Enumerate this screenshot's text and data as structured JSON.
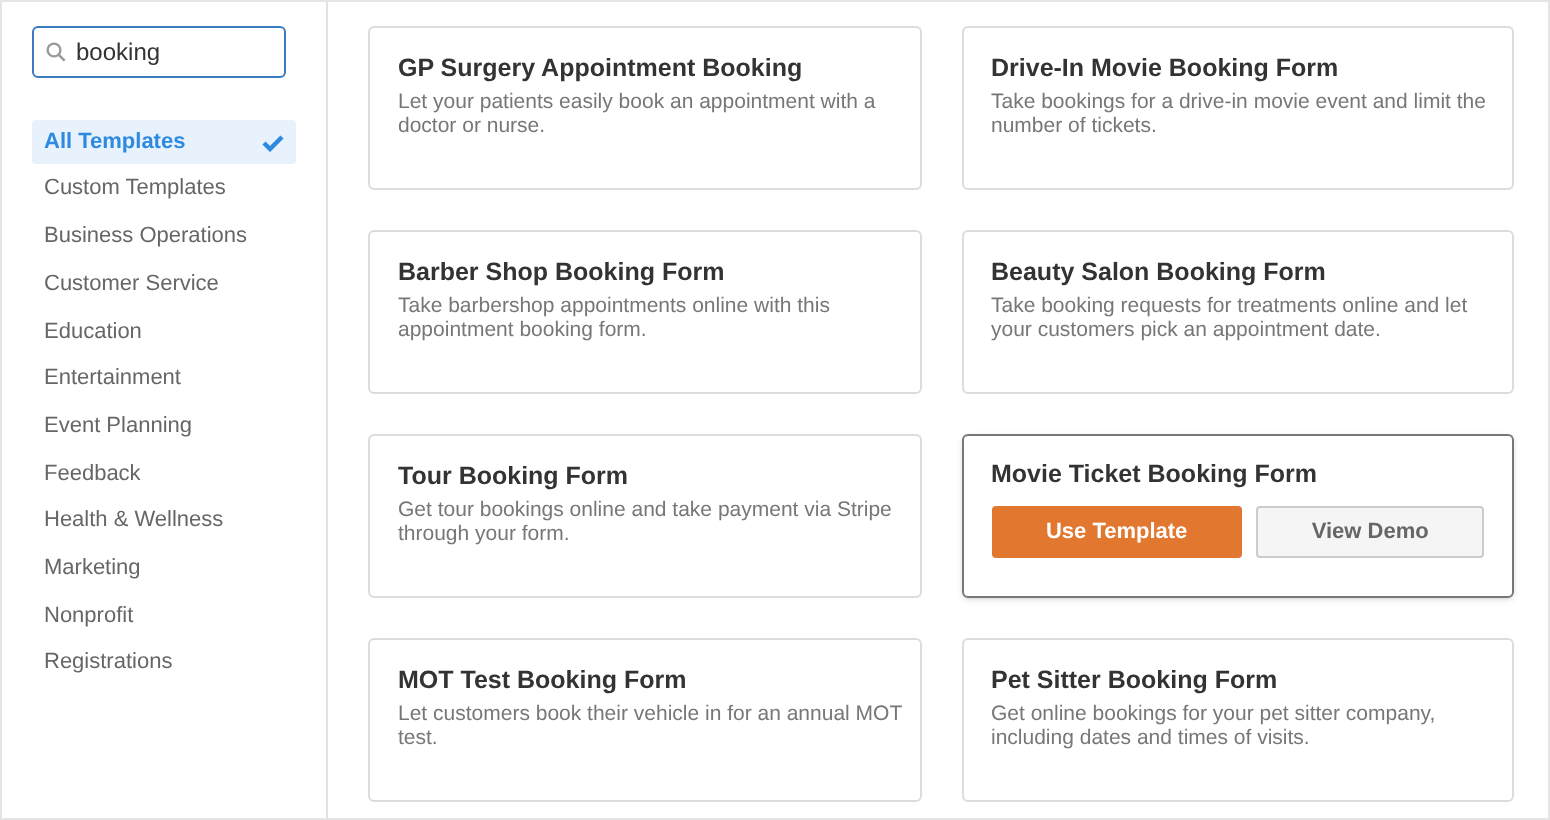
{
  "search": {
    "value": "booking"
  },
  "categories": [
    {
      "label": "All Templates",
      "selected": true
    },
    {
      "label": "Custom Templates",
      "selected": false
    },
    {
      "label": "Business Operations",
      "selected": false
    },
    {
      "label": "Customer Service",
      "selected": false
    },
    {
      "label": "Education",
      "selected": false
    },
    {
      "label": "Entertainment",
      "selected": false
    },
    {
      "label": "Event Planning",
      "selected": false
    },
    {
      "label": "Feedback",
      "selected": false
    },
    {
      "label": "Health & Wellness",
      "selected": false
    },
    {
      "label": "Marketing",
      "selected": false
    },
    {
      "label": "Nonprofit",
      "selected": false
    },
    {
      "label": "Registrations",
      "selected": false
    }
  ],
  "templates": [
    {
      "title": "GP Surgery Appointment Booking",
      "description": "Let your patients easily book an appointment with a doctor or nurse.",
      "hovered": false
    },
    {
      "title": "Drive-In Movie Booking Form",
      "description": "Take bookings for a drive-in movie event and limit the number of tickets.",
      "hovered": false
    },
    {
      "title": "Barber Shop Booking Form",
      "description": "Take barbershop appointments online with this appointment booking form.",
      "hovered": false
    },
    {
      "title": "Beauty Salon Booking Form",
      "description": "Take booking requests for treatments online and let your customers pick an appointment date.",
      "hovered": false
    },
    {
      "title": "Tour Booking Form",
      "description": "Get tour bookings online and take payment via Stripe through your form.",
      "hovered": false
    },
    {
      "title": "Movie Ticket Booking Form",
      "hovered": true,
      "buttons": [
        "Use Template",
        "View Demo"
      ]
    },
    {
      "title": "MOT Test Booking Form",
      "description": "Let customers book their vehicle in for an annual MOT test.",
      "hovered": false
    },
    {
      "title": "Pet Sitter Booking Form",
      "description": "Get online bookings for your pet sitter company, including dates and times of visits.",
      "hovered": false
    }
  ]
}
